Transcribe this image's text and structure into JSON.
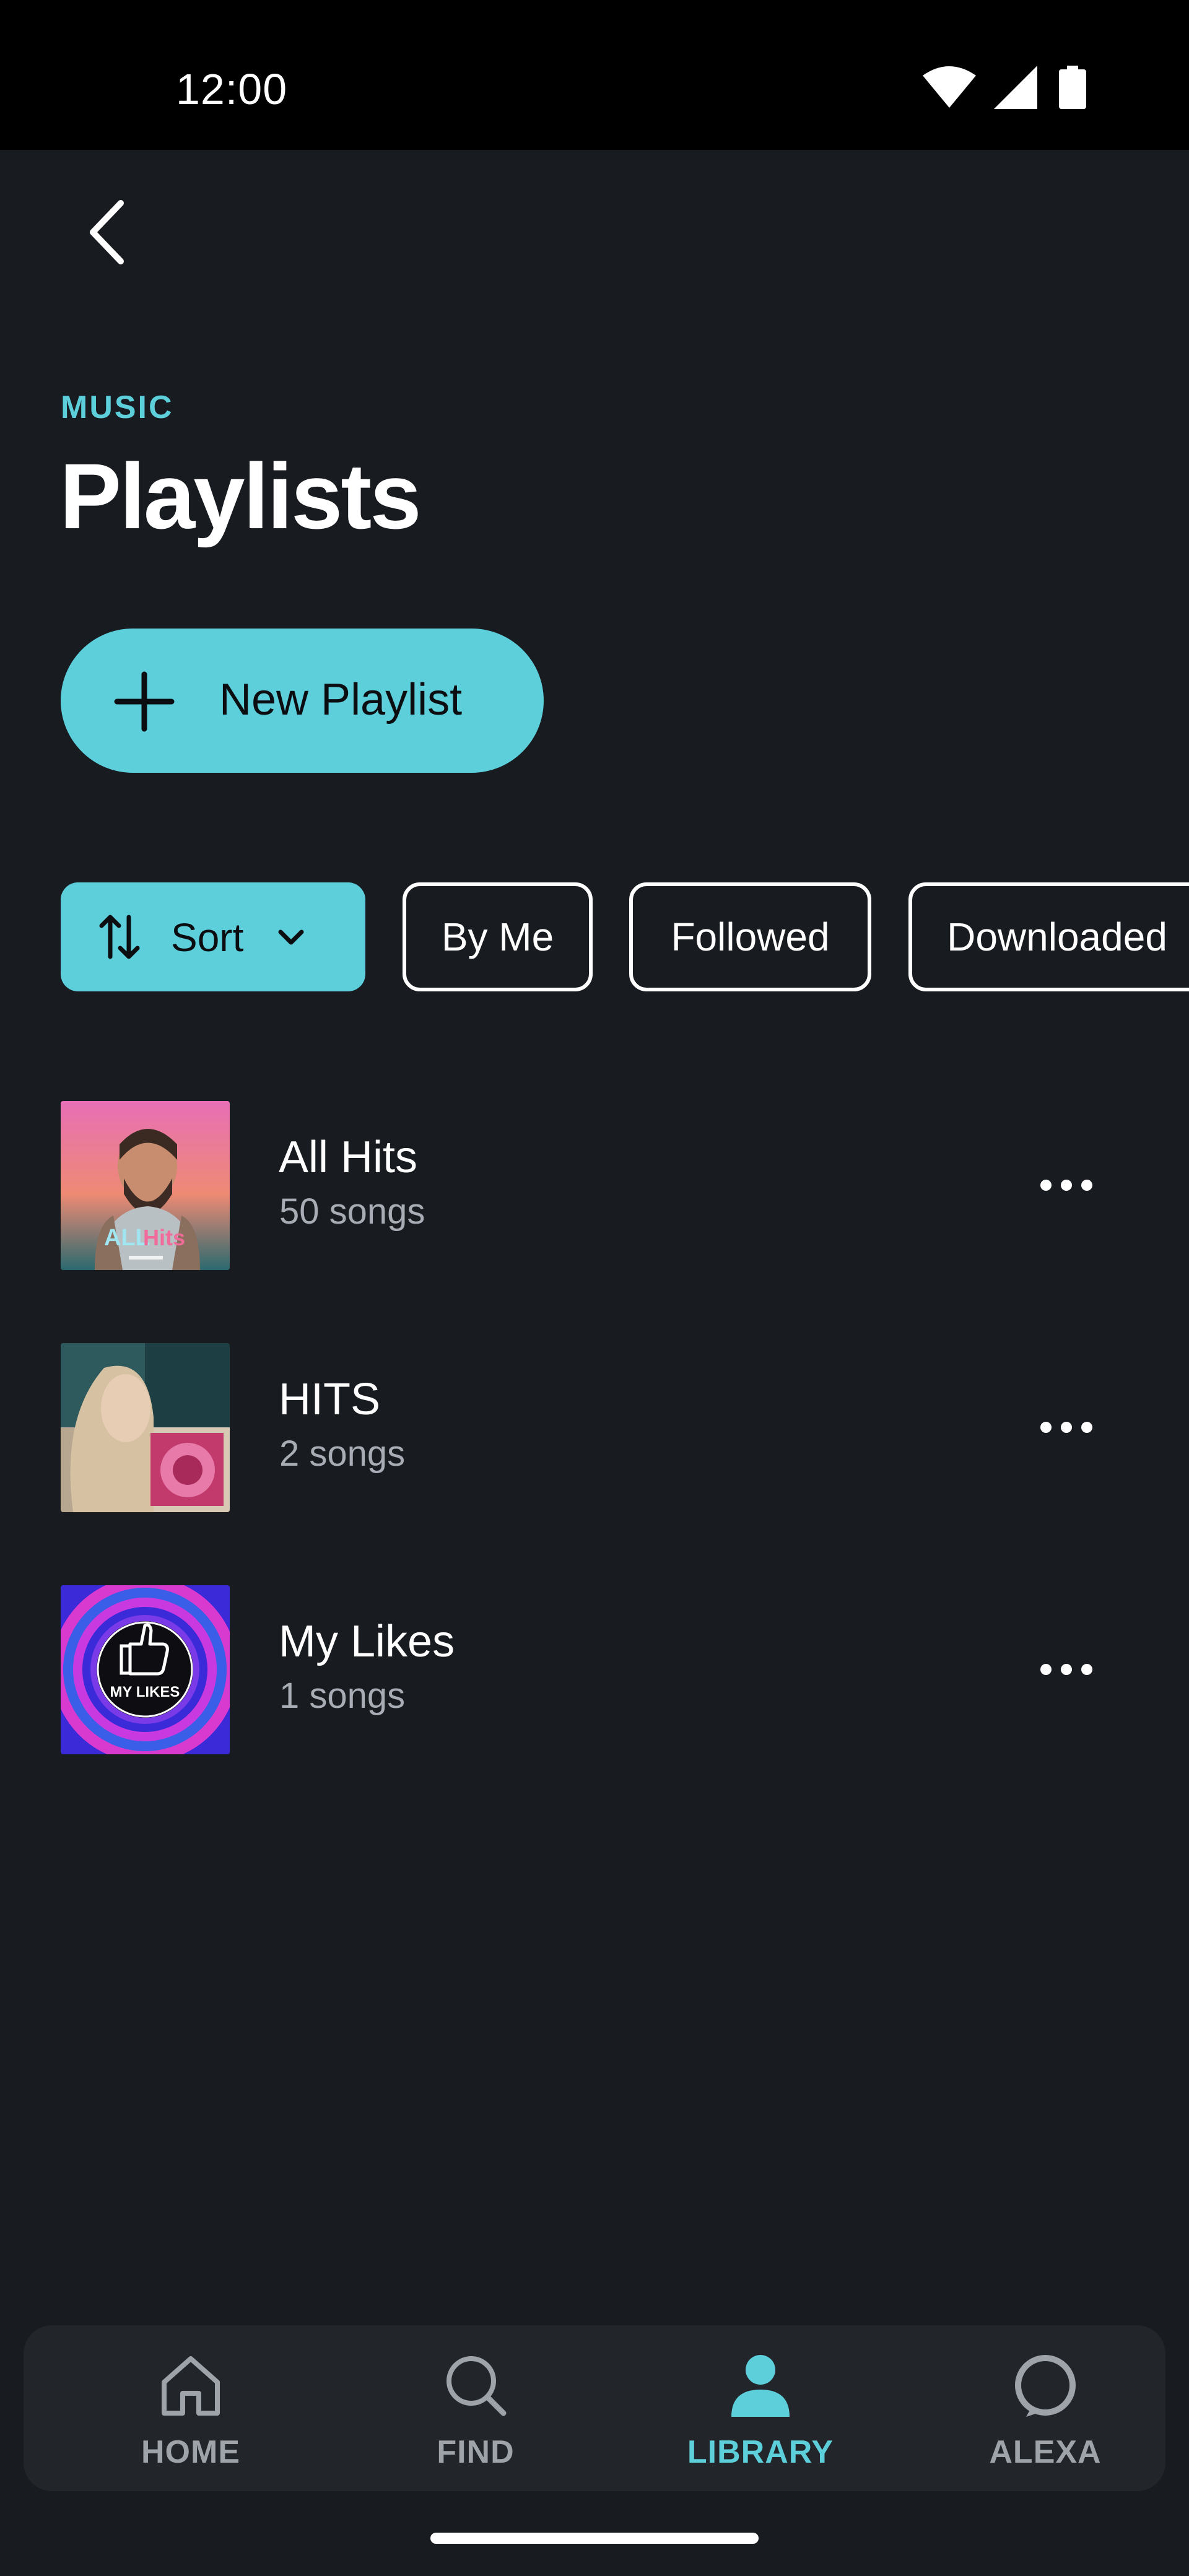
{
  "status_bar": {
    "time": "12:00",
    "icons": [
      "wifi-icon",
      "signal-icon",
      "battery-icon"
    ]
  },
  "header": {
    "back_icon": "chevron-left-icon",
    "eyebrow": "MUSIC",
    "title": "Playlists"
  },
  "new_playlist": {
    "label": "New Playlist",
    "icon": "plus-icon"
  },
  "filters": {
    "sort_label": "Sort",
    "chips": [
      "By Me",
      "Followed",
      "Downloaded"
    ]
  },
  "playlists": [
    {
      "title": "All Hits",
      "count": "50 songs",
      "art_text": "ALL Hits"
    },
    {
      "title": "HITS",
      "count": "2 songs",
      "art_text": ""
    },
    {
      "title": "My Likes",
      "count": "1 songs",
      "art_text": "MY LIKES"
    }
  ],
  "bottom_nav": {
    "items": [
      {
        "label": "HOME",
        "icon": "home-icon"
      },
      {
        "label": "FIND",
        "icon": "search-icon"
      },
      {
        "label": "LIBRARY",
        "icon": "person-icon"
      },
      {
        "label": "ALEXA",
        "icon": "alexa-ring-icon"
      }
    ],
    "active": "LIBRARY"
  },
  "colors": {
    "accent": "#5ccfdb",
    "background": "#181b20",
    "nav_background": "#22252a",
    "inactive": "#9ea3aa",
    "secondary_text": "#a8adb5"
  }
}
